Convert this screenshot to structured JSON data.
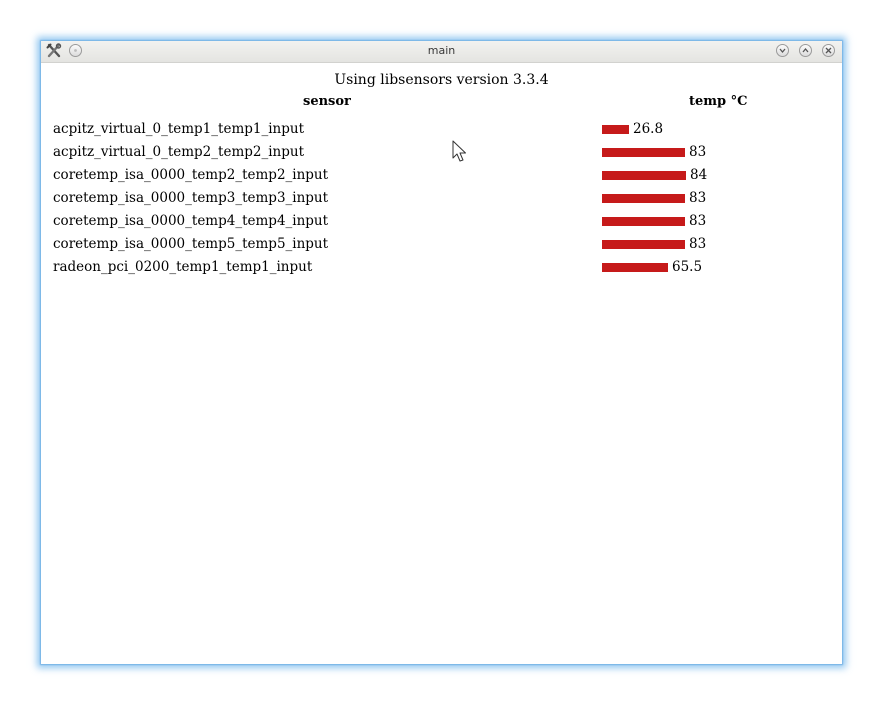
{
  "window": {
    "title": "main",
    "buttons": [
      "minimize",
      "maximize",
      "close"
    ]
  },
  "caption": "Using libsensors version 3.3.4",
  "table": {
    "columns": [
      "sensor",
      "temp °C"
    ],
    "bar_max": 100,
    "bar_color": "#c61a1a",
    "rows": [
      {
        "sensor": "acpitz_virtual_0_temp1_temp1_input",
        "temp": "26.8",
        "value": 26.8
      },
      {
        "sensor": "acpitz_virtual_0_temp2_temp2_input",
        "temp": "83",
        "value": 83
      },
      {
        "sensor": "coretemp_isa_0000_temp2_temp2_input",
        "temp": "84",
        "value": 84
      },
      {
        "sensor": "coretemp_isa_0000_temp3_temp3_input",
        "temp": "83",
        "value": 83
      },
      {
        "sensor": "coretemp_isa_0000_temp4_temp4_input",
        "temp": "83",
        "value": 83
      },
      {
        "sensor": "coretemp_isa_0000_temp5_temp5_input",
        "temp": "83",
        "value": 83
      },
      {
        "sensor": "radeon_pci_0200_temp1_temp1_input",
        "temp": "65.5",
        "value": 65.5
      }
    ]
  }
}
